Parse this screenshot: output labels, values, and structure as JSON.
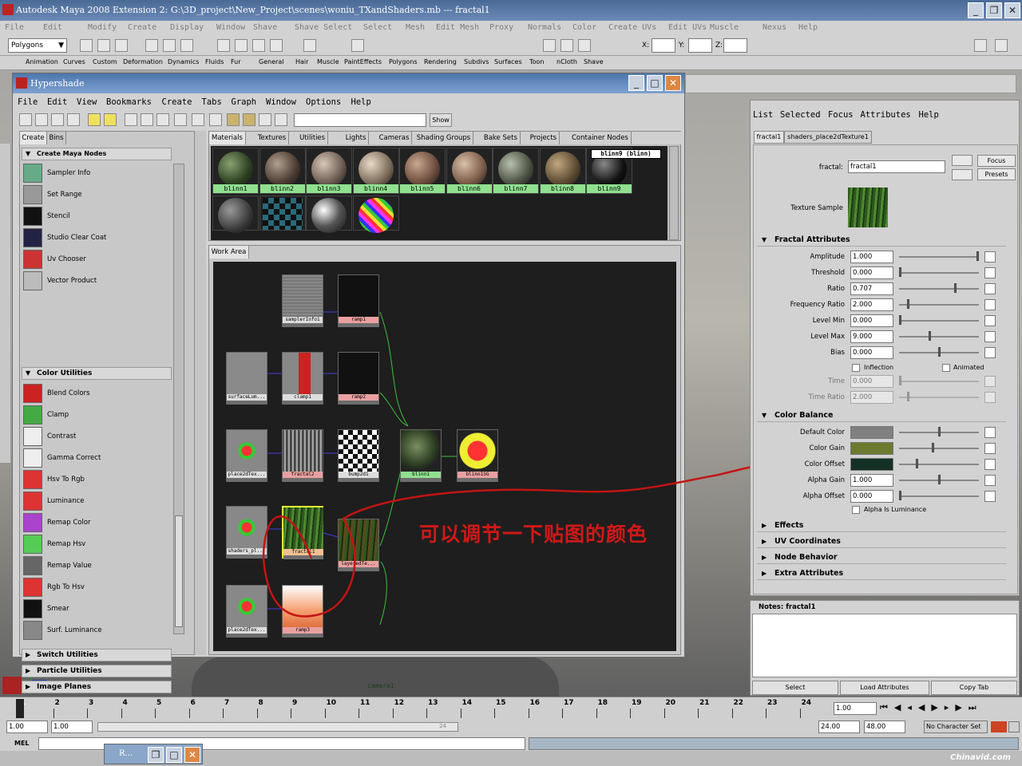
{
  "window": {
    "title": "Autodesk Maya 2008 Extension 2: G:\\3D_project\\New_Project\\scenes\\woniu_TXandShaders.mb   ---   fractal1"
  },
  "main_menu": [
    "File",
    "Edit",
    "Modify",
    "Create",
    "Display",
    "Window",
    "Shave",
    "Shave Select",
    "Select",
    "Mesh",
    "Edit Mesh",
    "Proxy",
    "Normals",
    "Color",
    "Create UVs",
    "Edit UVs",
    "Muscle",
    "Nexus",
    "Help"
  ],
  "status": {
    "mode": "Polygons",
    "x_label": "X:",
    "y_label": "Y:",
    "z_label": "Z:"
  },
  "shelf_tabs": [
    "Animation",
    "Curves",
    "Custom",
    "Deformation",
    "Dynamics",
    "Fluids",
    "Fur",
    "General",
    "Hair",
    "Muscle",
    "PaintEffects",
    "Polygons",
    "Rendering",
    "Subdivs",
    "Surfaces",
    "Toon",
    "nCloth",
    "Shave"
  ],
  "hypershade": {
    "title": "Hypershade",
    "menu": [
      "File",
      "Edit",
      "View",
      "Bookmarks",
      "Create",
      "Tabs",
      "Graph",
      "Window",
      "Options",
      "Help"
    ],
    "show_label": "Show",
    "left_tabs": [
      "Create",
      "Bins"
    ],
    "create_header": "Create Maya Nodes",
    "nodes_top": [
      "Sampler Info",
      "Set Range",
      "Stencil",
      "Studio Clear Coat",
      "Uv Chooser",
      "Vector Product"
    ],
    "color_utilities_header": "Color Utilities",
    "color_utilities": [
      "Blend Colors",
      "Clamp",
      "Contrast",
      "Gamma Correct",
      "Hsv To Rgb",
      "Luminance",
      "Remap Color",
      "Remap Hsv",
      "Remap Value",
      "Rgb To Hsv",
      "Smear",
      "Surf. Luminance"
    ],
    "sections": [
      "Switch Utilities",
      "Particle Utilities",
      "Image Planes",
      "Glow"
    ],
    "scroll_left": "<<",
    "scroll_right": ">>",
    "mat_tabs": [
      "Materials",
      "Textures",
      "Utilities",
      "Lights",
      "Cameras",
      "Shading Groups",
      "Bake Sets",
      "Projects",
      "Container Nodes"
    ],
    "materials": [
      "blinn1",
      "blinn2",
      "blinn3",
      "blinn4",
      "blinn5",
      "blinn6",
      "blinn7",
      "blinn8",
      "blinn9"
    ],
    "tooltip": "blinn9 (blinn)",
    "work_area_tab": "Work Area",
    "graph_nodes": [
      "samplerInfo1",
      "ramp1",
      "surfaceLum...",
      "clamp1",
      "ramp2",
      "place2dTex...",
      "fractal2",
      "bump2d1",
      "blinn1",
      "blinn1SG",
      "shaders_pl...",
      "fractal1",
      "layeredTe...",
      "place2dTex...",
      "ramp3"
    ],
    "camera_label": "camera1"
  },
  "attribute_editor": {
    "menu": [
      "List",
      "Selected",
      "Focus",
      "Attributes",
      "Help"
    ],
    "tabs": [
      "fractal1",
      "shaders_place2dTexture1"
    ],
    "node_label": "fractal:",
    "node_value": "fractal1",
    "focus": "Focus",
    "presets": "Presets",
    "texture_sample": "Texture Sample",
    "fractal_header": "Fractal Attributes",
    "fractal_attrs": [
      {
        "label": "Amplitude",
        "value": "1.000",
        "slider": 1.0
      },
      {
        "label": "Threshold",
        "value": "0.000",
        "slider": 0.0
      },
      {
        "label": "Ratio",
        "value": "0.707",
        "slider": 0.707
      },
      {
        "label": "Frequency Ratio",
        "value": "2.000",
        "slider": 0.1
      },
      {
        "label": "Level Min",
        "value": "0.000",
        "slider": 0.0
      },
      {
        "label": "Level Max",
        "value": "9.000",
        "slider": 0.38
      },
      {
        "label": "Bias",
        "value": "0.000",
        "slider": 0.5
      }
    ],
    "inflection": "Inflection",
    "animated": "Animated",
    "time": {
      "label": "Time",
      "value": "0.000"
    },
    "time_ratio": {
      "label": "Time Ratio",
      "value": "2.000"
    },
    "color_balance_header": "Color Balance",
    "color_attrs": [
      {
        "label": "Default Color",
        "color": "#808080",
        "slider": 0.5
      },
      {
        "label": "Color Gain",
        "color": "#6b7a2e",
        "slider": 0.42
      },
      {
        "label": "Color Offset",
        "color": "#143025",
        "slider": 0.22
      }
    ],
    "alpha_gain": {
      "label": "Alpha Gain",
      "value": "1.000",
      "slider": 0.5
    },
    "alpha_offset": {
      "label": "Alpha Offset",
      "value": "0.000",
      "slider": 0.0
    },
    "alpha_is_lum": "Alpha Is Luminance",
    "collapsed": [
      "Effects",
      "UV Coordinates",
      "Node Behavior",
      "Extra Attributes"
    ],
    "notes_label": "Notes:  fractal1",
    "buttons": [
      "Select",
      "Load Attributes",
      "Copy Tab"
    ]
  },
  "annotation": "可以调节一下贴图的颜色",
  "timeline": {
    "ticks": [
      "1",
      "2",
      "3",
      "4",
      "5",
      "6",
      "7",
      "8",
      "9",
      "10",
      "11",
      "12",
      "13",
      "14",
      "15",
      "16",
      "17",
      "18",
      "19",
      "20",
      "21",
      "22",
      "23",
      "24"
    ],
    "current_frame": "1.00",
    "range_start": "1.00",
    "range_start2": "1.00",
    "range_mid": "24",
    "range_end": "24.00",
    "anim_end": "48.00",
    "character_set": "No Character Set",
    "mel": "MEL"
  },
  "watermark": "Chinavid.com",
  "taskbar_item": "R..."
}
